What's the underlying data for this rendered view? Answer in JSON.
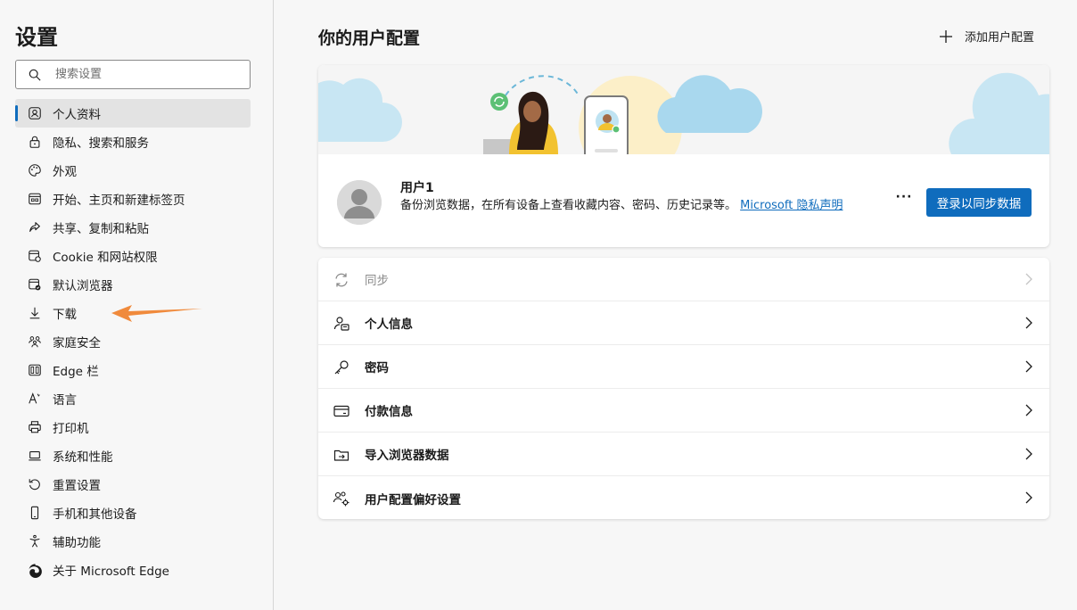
{
  "sidebar": {
    "title": "设置",
    "search": {
      "placeholder": "搜索设置",
      "value": ""
    },
    "items": [
      {
        "label": "个人资料",
        "icon": "profile-icon",
        "active": true
      },
      {
        "label": "隐私、搜索和服务",
        "icon": "lock-icon"
      },
      {
        "label": "外观",
        "icon": "palette-icon"
      },
      {
        "label": "开始、主页和新建标签页",
        "icon": "start-page-icon"
      },
      {
        "label": "共享、复制和粘贴",
        "icon": "share-icon"
      },
      {
        "label": "Cookie 和网站权限",
        "icon": "cookie-site-permissions-icon"
      },
      {
        "label": "默认浏览器",
        "icon": "default-browser-icon"
      },
      {
        "label": "下载",
        "icon": "download-icon"
      },
      {
        "label": "家庭安全",
        "icon": "family-icon"
      },
      {
        "label": "Edge 栏",
        "icon": "edge-bar-icon"
      },
      {
        "label": "语言",
        "icon": "language-icon"
      },
      {
        "label": "打印机",
        "icon": "printer-icon"
      },
      {
        "label": "系统和性能",
        "icon": "laptop-icon"
      },
      {
        "label": "重置设置",
        "icon": "reset-icon"
      },
      {
        "label": "手机和其他设备",
        "icon": "phone-icon"
      },
      {
        "label": "辅助功能",
        "icon": "accessibility-icon"
      },
      {
        "label": "关于 Microsoft Edge",
        "icon": "edge-logo-icon"
      }
    ]
  },
  "main": {
    "title": "你的用户配置",
    "add_profile_label": "添加用户配置",
    "profile": {
      "name": "用户1",
      "description": "备份浏览数据，在所有设备上查看收藏内容、密码、历史记录等。",
      "privacy_link": "Microsoft 隐私声明",
      "more_label": "···",
      "signin_label": "登录以同步数据"
    },
    "rows": [
      {
        "label": "同步",
        "icon": "sync-icon",
        "disabled": true
      },
      {
        "label": "个人信息",
        "icon": "personal-info-icon"
      },
      {
        "label": "密码",
        "icon": "key-icon"
      },
      {
        "label": "付款信息",
        "icon": "credit-card-icon"
      },
      {
        "label": "导入浏览器数据",
        "icon": "import-icon"
      },
      {
        "label": "用户配置偏好设置",
        "icon": "profile-preferences-icon"
      }
    ]
  },
  "colors": {
    "accent": "#0f6cbd",
    "annotation_arrow": "#f08a3c",
    "sidebar_bg": "#f7f7f7"
  }
}
